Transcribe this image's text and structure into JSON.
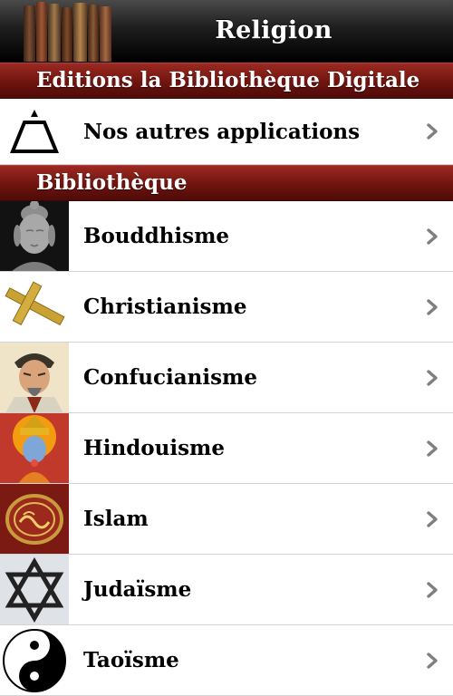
{
  "navbar": {
    "title": "Religion"
  },
  "sections": {
    "editions": {
      "header": "Editions la Bibliothèque Digitale",
      "items": [
        {
          "label": "Nos autres applications",
          "icon": "pyramid-eye-icon"
        }
      ]
    },
    "library": {
      "header": "Bibliothèque",
      "items": [
        {
          "label": "Bouddhisme",
          "icon": "buddha-head-icon"
        },
        {
          "label": "Christianisme",
          "icon": "cross-icon"
        },
        {
          "label": "Confucianisme",
          "icon": "confucius-portrait-icon"
        },
        {
          "label": "Hindouisme",
          "icon": "hindu-deity-icon"
        },
        {
          "label": "Islam",
          "icon": "quran-cover-icon"
        },
        {
          "label": "Judaïsme",
          "icon": "star-of-david-icon"
        },
        {
          "label": "Taoïsme",
          "icon": "yin-yang-icon"
        }
      ]
    }
  },
  "colors": {
    "header_red": "#6f140f",
    "navbar_black": "#1e1e1e",
    "chevron_gray": "#7f7f7f"
  }
}
